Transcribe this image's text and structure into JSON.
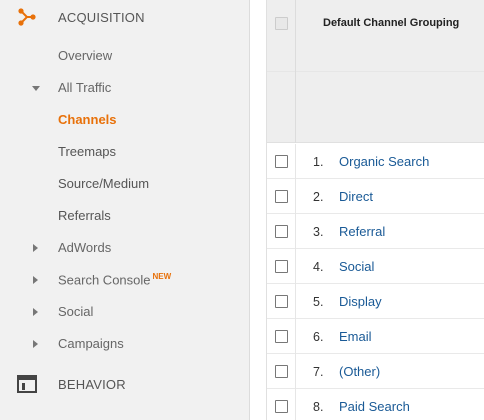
{
  "sidebar": {
    "acquisition": {
      "label": "ACQUISITION",
      "icon": "acquisition-icon"
    },
    "items": [
      {
        "label": "Overview"
      },
      {
        "label": "All Traffic"
      },
      {
        "label": "Channels"
      },
      {
        "label": "Treemaps"
      },
      {
        "label": "Source/Medium"
      },
      {
        "label": "Referrals"
      },
      {
        "label": "AdWords"
      },
      {
        "label": "Search Console",
        "badge": "NEW"
      },
      {
        "label": "Social"
      },
      {
        "label": "Campaigns"
      }
    ],
    "behavior": {
      "label": "BEHAVIOR",
      "icon": "behavior-icon"
    }
  },
  "table": {
    "header": "Default Channel Grouping",
    "rows": [
      {
        "num": "1.",
        "name": "Organic Search"
      },
      {
        "num": "2.",
        "name": "Direct"
      },
      {
        "num": "3.",
        "name": "Referral"
      },
      {
        "num": "4.",
        "name": "Social"
      },
      {
        "num": "5.",
        "name": "Display"
      },
      {
        "num": "6.",
        "name": "Email"
      },
      {
        "num": "7.",
        "name": "(Other)"
      },
      {
        "num": "8.",
        "name": "Paid Search"
      }
    ]
  },
  "colors": {
    "accent": "#e8710a",
    "link": "#1a5a96"
  }
}
